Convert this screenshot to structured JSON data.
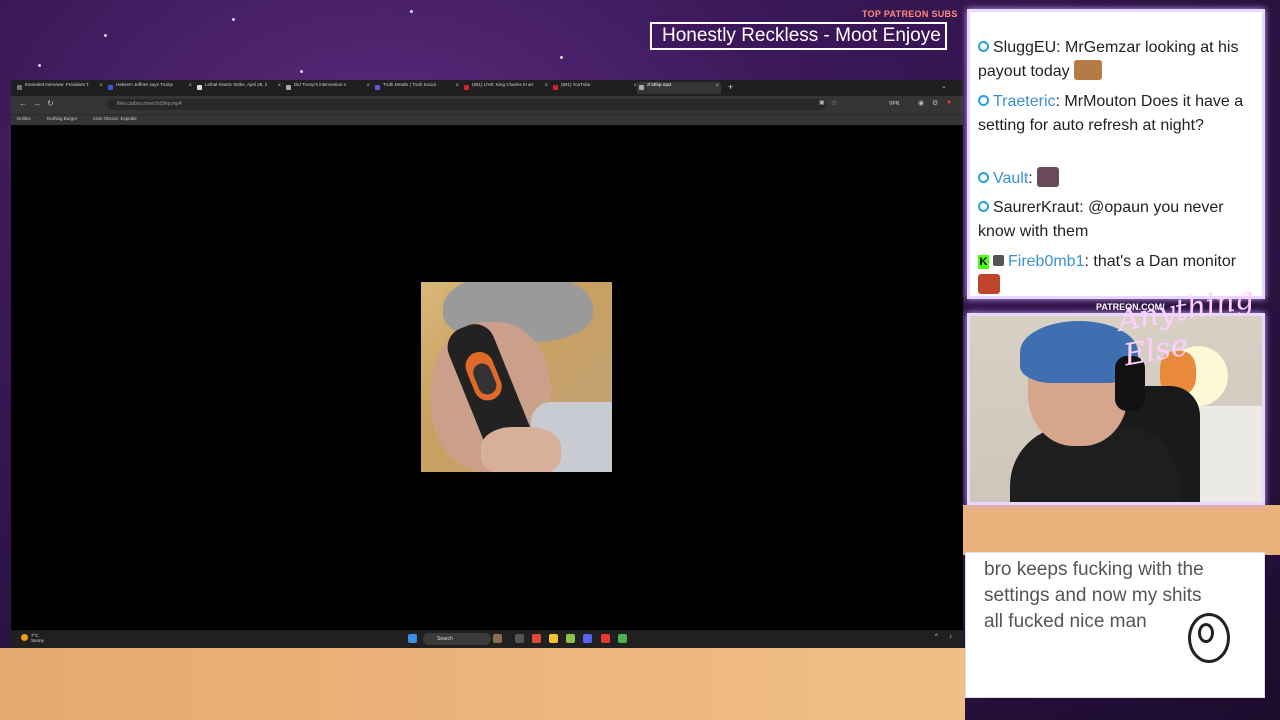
{
  "overlay": {
    "top_patreon_label": "TOP PATREON SUBS",
    "marquee_text": "Honestly Reckless - Moot Enjoye",
    "patreon_url_label": "PATREON.COM/",
    "brand_cursive": "Anything Else"
  },
  "chat": {
    "messages": [
      {
        "user": "SluggEU",
        "text": "MrGemzar looking at his payout today",
        "user_color": "#222222"
      },
      {
        "user": "Traeteric",
        "text": "MrMouton Does it have a setting for auto refresh at night?",
        "user_color": "#3a8fd0"
      },
      {
        "user": "Vault",
        "text": "",
        "user_color": "#3a8fd0"
      },
      {
        "user": "SaurerKraut",
        "text": "@opaun you never know with them",
        "user_color": "#222222"
      },
      {
        "user": "Fireb0mb1",
        "text": "that's a Dan monitor",
        "user_color": "#3a8fd0"
      }
    ]
  },
  "browser": {
    "tabs": [
      "Extended Interview: President T",
      "Hakeem Jeffries says Trump",
      "Lethal Kinetic Strike, April 26, 2",
      "Did Trump's intervention s",
      "Truth Details | Truth Social",
      "(681) LIVE: King Charles III arr",
      "(681) YouTube",
      "zhi3fep.mp4"
    ],
    "url": "files.catbox.moe/zhi3fep.mp4",
    "vpn_label": "VPN",
    "bookmarks": [
      "Dollies",
      "Nothing Burger",
      "Clair Obscur: Expediti"
    ]
  },
  "taskbar": {
    "weather_temp": "7°C",
    "weather_desc": "Sunny",
    "search_placeholder": "Search"
  },
  "quote_box": {
    "text": "bro keeps fucking with the settings and now my shits all fucked nice man"
  }
}
